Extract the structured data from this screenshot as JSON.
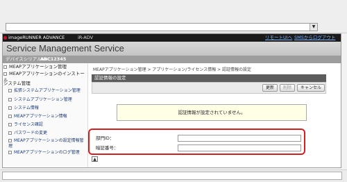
{
  "header": {
    "brand": "imageRUNNER ADVANCE",
    "model": "iR-ADV",
    "remote_ui_link": "リモートUIへ",
    "logout_link": "SMSからログアウト",
    "title": "Service Management Service",
    "serial_label": "デバイスシリアルNo.：",
    "serial_value": "ABC12345"
  },
  "sidebar": {
    "meap_manage": "MEAPアプリケーション管理",
    "meap_install": "MEAPアプリケーションのインストール",
    "system_manage": "システム管理",
    "items": [
      "拡張システムアプリケーション管理",
      "システムアプリケーション管理",
      "システム情報",
      "MEAPアプリケーション情報",
      "ライセンス確認",
      "パスワードの変更",
      "MEAPアプリケーションの設定情報管理",
      "MEAPアプリケーションのログ管理"
    ]
  },
  "content": {
    "breadcrumb": "MEAPアプリケーション管理 > アプリケーション/ライセンス情報 > 認証情報の設定",
    "panel_title": "認証情報の設定",
    "update_button": "更新",
    "delete_button": "削除",
    "cancel_button": "キャンセル",
    "message": "認証情報が設定されていません。",
    "dept_id_label": "部門ID：",
    "pin_label": "暗証番号："
  },
  "addressbar": {
    "dropdown_glyph": "▼"
  },
  "toplink": {
    "glyph": "▲"
  }
}
